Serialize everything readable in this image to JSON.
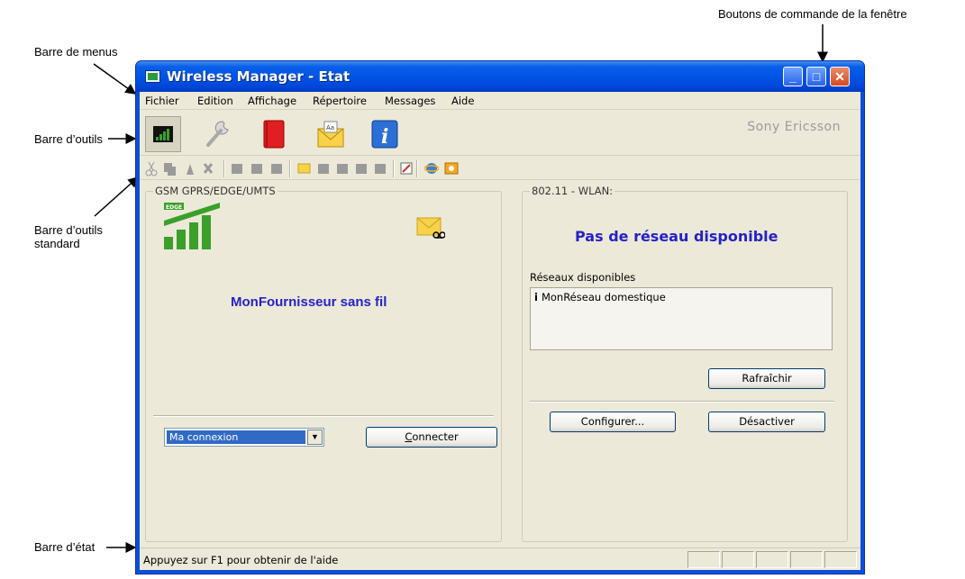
{
  "annotations": {
    "window_buttons": "Boutons de commande de la fenêtre",
    "menubar": "Barre de menus",
    "toolbar": "Barre d’outils",
    "std_toolbar_line1": "Barre d’outils",
    "std_toolbar_line2": "standard",
    "statusbar": "Barre d’état"
  },
  "window": {
    "title": "Wireless Manager - Etat",
    "controls": {
      "minimize": "minimize-icon",
      "maximize": "maximize-icon",
      "close": "close-icon"
    }
  },
  "menu": [
    "Fichier",
    "Edition",
    "Affichage",
    "Répertoire",
    "Messages",
    "Aide"
  ],
  "toolbar": {
    "brand": "Sony Ericsson",
    "buttons": [
      "signal-status-icon",
      "wrench-icon",
      "phonebook-icon",
      "message-envelope-icon",
      "info-icon"
    ]
  },
  "gsm": {
    "group_label": "GSM GPRS/EDGE/UMTS",
    "badge": "EDGE",
    "provider": "MonFournisseur sans fil",
    "connection_value": "Ma connexion",
    "connect_label_first": "C",
    "connect_label_rest": "onnecter"
  },
  "wlan": {
    "group_label": "802.11 - WLAN:",
    "status": "Pas de réseau disponible",
    "available_label": "Réseaux disponibles",
    "networks": [
      "MonRéseau domestique"
    ],
    "refresh_label": "Rafraîchir",
    "configure_label": "Configurer...",
    "disable_label": "Désactiver"
  },
  "status": {
    "text": "Appuyez sur F1 pour obtenir de l'aide"
  },
  "colors": {
    "title_blue": "#0055e5",
    "accent_text": "#2521c8",
    "signal_green": "#3aa02a",
    "window_bg": "#ece9d8"
  }
}
